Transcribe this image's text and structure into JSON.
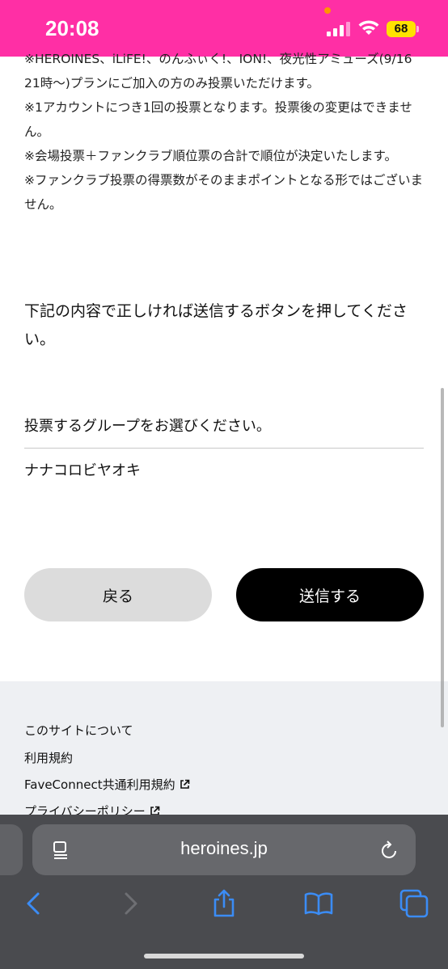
{
  "status": {
    "time": "20:08",
    "battery": "68"
  },
  "notes": [
    "※HEROINES、iLiFE!、のんふぃく!、ION!、夜光性アミューズ(9/16 21時〜)プランにご加入の方のみ投票いただけます。",
    "※1アカウントにつき1回の投票となります。投票後の変更はできません。",
    "※会場投票＋ファンクラブ順位票の合計で順位が決定いたします。",
    "※ファンクラブ投票の得票数がそのままポイントとなる形ではございません。"
  ],
  "instruction": "下記の内容で正しければ送信するボタンを押してください。",
  "form": {
    "label": "投票するグループをお選びください。",
    "value": "ナナコロビヤオキ"
  },
  "buttons": {
    "back": "戻る",
    "submit": "送信する"
  },
  "footer": {
    "links": [
      "このサイトについて",
      "利用規約",
      "FaveConnect共通利用規約",
      "プライバシーポリシー"
    ]
  },
  "browser": {
    "url": "heroines.jp"
  },
  "colors": {
    "status_bar": "#ff2fa5",
    "submit_button": "#000000",
    "back_button": "#dcdcdc",
    "footer_bg": "#eef0f3",
    "toolbar_icon": "#3b8cf5"
  }
}
